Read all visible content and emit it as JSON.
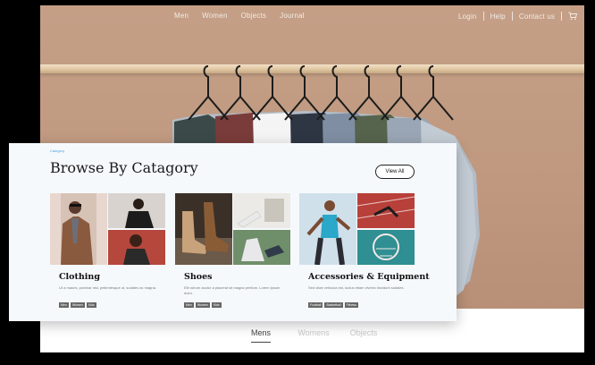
{
  "nav": {
    "center": [
      "Men",
      "Women",
      "Objects",
      "Journal"
    ],
    "right": [
      "Login",
      "Help",
      "Contact us"
    ],
    "cart_icon": "cart-icon"
  },
  "card": {
    "breadcrumb": "Category",
    "title": "Browse By Catagory",
    "view_all": "View All",
    "categories": [
      {
        "name": "Clothing",
        "desc": "Ut a mauris, pulvinar nisi, pellentesque ut, sodales ac magna.",
        "tags": [
          "Men",
          "Women",
          "Kids"
        ]
      },
      {
        "name": "Shoes",
        "desc": "Elit rutrum auctor a placerat sit magna pretium. Lorem ipsum dolor.",
        "tags": [
          "Men",
          "Women",
          "Kids"
        ]
      },
      {
        "name": "Accessories & Equipment",
        "desc": "Sed vitae vehicula est, luctus etiam viverra tincidunt sodales.",
        "tags": [
          "Football",
          "Basketball",
          "Fitness"
        ]
      }
    ]
  },
  "tabs": [
    "Mens",
    "Womens",
    "Objects"
  ],
  "colors": {
    "hero_bg": "#c49f86",
    "card_bg": "#f6f9fc",
    "accent": "#4aa3d8"
  }
}
